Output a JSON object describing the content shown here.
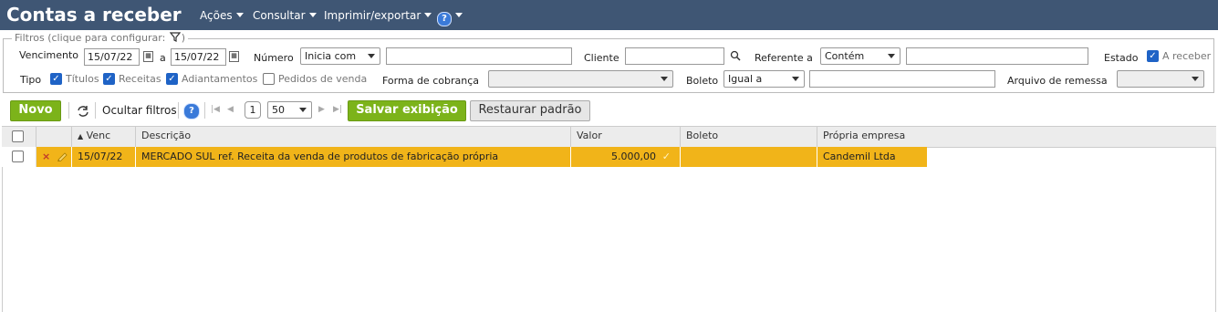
{
  "app": {
    "title": "Contas a receber"
  },
  "menu": {
    "acoes": "Ações",
    "consultar": "Consultar",
    "imprimir": "Imprimir/exportar",
    "help": "?"
  },
  "filters": {
    "legend": "Filtros (clique para configurar:",
    "legend_close": ")",
    "vencimento_label": "Vencimento",
    "venc_from": "15/07/22",
    "venc_to_label": "a",
    "venc_to": "15/07/22",
    "numero_label": "Número",
    "numero_op": "Inicia com",
    "numero_value": "",
    "cliente_label": "Cliente",
    "cliente_value": "",
    "referente_label": "Referente a",
    "referente_op": "Contém",
    "referente_value": "",
    "estado_label": "Estado",
    "estado_a_receber": "A receber",
    "tipo_label": "Tipo",
    "tipo_titulos": "Títulos",
    "tipo_receitas": "Receitas",
    "tipo_adiantamentos": "Adiantamentos",
    "tipo_pedidos": "Pedidos de venda",
    "forma_label": "Forma de cobrança",
    "forma_value": "",
    "boleto_label": "Boleto",
    "boleto_op": "Igual a",
    "boleto_value": "",
    "arquivo_label": "Arquivo de remessa",
    "arquivo_value": ""
  },
  "toolbar": {
    "novo": "Novo",
    "ocultar_filtros": "Ocultar filtros",
    "help": "?",
    "page": "1",
    "page_size": "50",
    "salvar": "Salvar exibição",
    "restaurar": "Restaurar padrão"
  },
  "table": {
    "columns": [
      "Venc",
      "Descrição",
      "Valor",
      "Boleto",
      "Própria empresa"
    ],
    "rows": [
      {
        "venc": "15/07/22",
        "descricao": "MERCADO SUL ref. Receita da venda de produtos de fabricação própria",
        "valor": "5.000,00",
        "boleto": "",
        "empresa": "Candemil Ltda"
      }
    ]
  },
  "colors": {
    "topbar": "#3f5674",
    "accent_green": "#7cb31a",
    "row_highlight": "#f1b419",
    "checkbox_blue": "#1f63c6"
  }
}
